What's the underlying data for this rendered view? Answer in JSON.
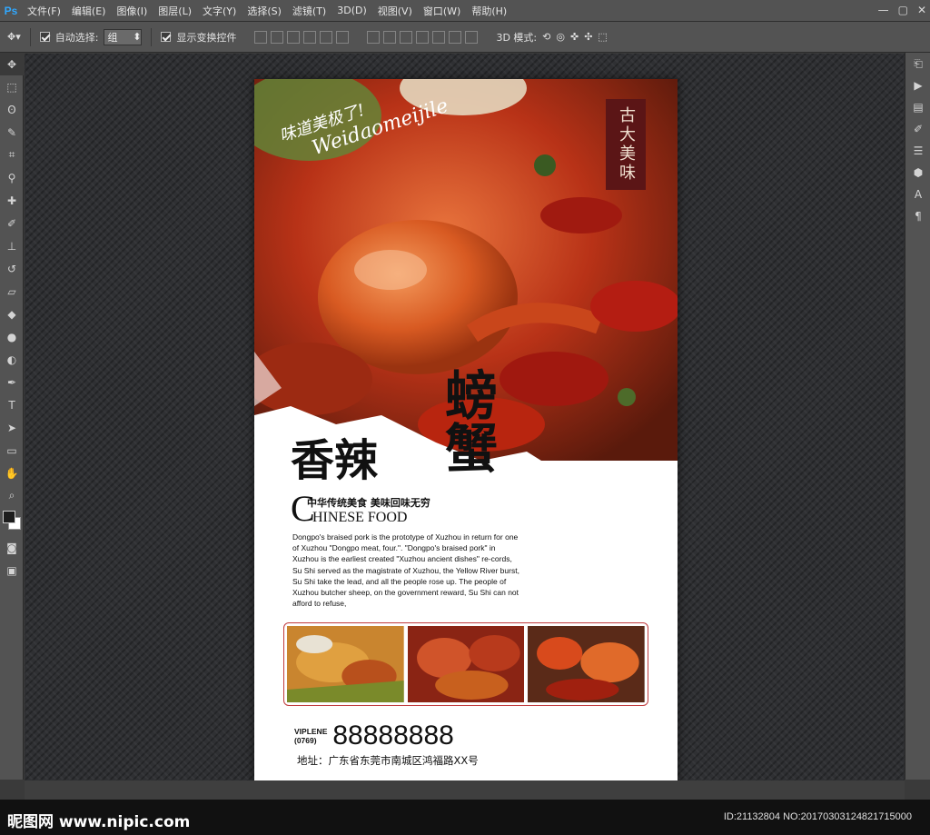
{
  "app": {
    "logo": "Ps"
  },
  "menu": [
    "文件(F)",
    "编辑(E)",
    "图像(I)",
    "图层(L)",
    "文字(Y)",
    "选择(S)",
    "滤镜(T)",
    "3D(D)",
    "视图(V)",
    "窗口(W)",
    "帮助(H)"
  ],
  "options": {
    "auto_select_label": "自动选择:",
    "auto_select_checked": true,
    "auto_select_value": "组",
    "transform_label": "显示变换控件",
    "transform_checked": true,
    "mode_3d_label": "3D 模式:"
  },
  "tools": [
    "move-tool",
    "marquee-tool",
    "lasso-tool",
    "quick-select-tool",
    "crop-tool",
    "eyedropper-tool",
    "healing-tool",
    "brush-tool",
    "stamp-tool",
    "history-brush-tool",
    "eraser-tool",
    "bucket-tool",
    "blur-tool",
    "dodge-tool",
    "pen-tool",
    "type-tool",
    "path-select-tool",
    "shape-tool",
    "hand-tool",
    "zoom-tool"
  ],
  "colors": {
    "foreground": "#1d1d1d",
    "background": "#ffffff",
    "accent_red": "#c0393b",
    "seal": "#5b1516"
  },
  "poster": {
    "script_cn": "味道美极了!",
    "script_en": "Weidaomeijile",
    "seal_text": "古大美味",
    "title_left": "香辣",
    "title_right": "螃蟹",
    "cn_subtitle": "中华传统美食  美味回味无穷",
    "c_letter": "C",
    "en_subtitle": "HINESE FOOD",
    "body": "Dongpo's braised pork is the prototype of Xuzhou in return for one of Xuzhou \"Dongpo meat, four.\". \"Dongpo's braised pork\" in Xuzhou is the earliest created \"Xuzhou ancient dishes\" re-cords, Su Shi served as the magistrate of Xuzhou, the Yellow River burst, Su Shi take the lead, and all the people rose up. The people of Xuzhou butcher sheep, on the government reward, Su Shi can not afford to refuse,",
    "phone_label_1": "VIPLENE",
    "phone_label_2": "(0769)",
    "phone_number": "88888888",
    "address": "地址：广东省东莞市南城区鸿福路XX号"
  },
  "footer": {
    "logo": "昵图网 www.nipic.com",
    "id": "ID:21132804 NO:20170303124821715000"
  }
}
